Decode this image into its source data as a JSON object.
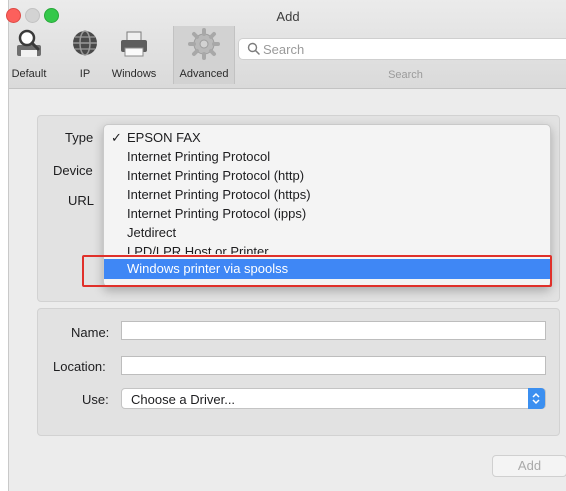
{
  "window": {
    "title": "Add"
  },
  "toolbar": {
    "items": [
      {
        "label": "Default",
        "icon": "default-printer-icon"
      },
      {
        "label": "IP",
        "icon": "globe-icon"
      },
      {
        "label": "Windows",
        "icon": "windows-printer-icon"
      },
      {
        "label": "Advanced",
        "icon": "gear-icon",
        "selected": true
      }
    ],
    "search": {
      "placeholder": "Search",
      "caption": "Search"
    }
  },
  "form": {
    "type_label": "Type",
    "device_label": "Device",
    "url_label": "URL",
    "name_label": "Name:",
    "name_value": "",
    "location_label": "Location:",
    "location_value": "",
    "use_label": "Use:",
    "use_value": "Choose a Driver..."
  },
  "type_menu": {
    "check_mark": "✓",
    "options": [
      "EPSON FAX",
      "Internet Printing Protocol",
      "Internet Printing Protocol (http)",
      "Internet Printing Protocol (https)",
      "Internet Printing Protocol (ipps)",
      "Jetdirect",
      "LPD/LPR Host or Printer",
      "Windows printer via spoolss"
    ],
    "checked": "EPSON FAX",
    "highlighted": "Windows printer via spoolss"
  },
  "buttons": {
    "add_label": "Add"
  },
  "colors": {
    "accent": "#3f87f5",
    "annotation": "#e0302a"
  }
}
